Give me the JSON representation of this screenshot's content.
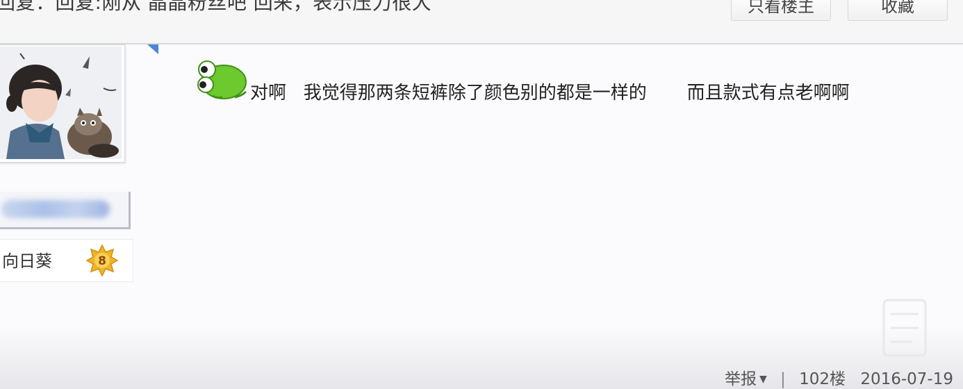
{
  "header": {
    "title": "回复：回复:刚从 晶晶粉丝吧 回来，表示压力很大",
    "only_op_label": "只看楼主",
    "favorite_label": "收藏"
  },
  "user": {
    "level_name": "向日葵",
    "level_number": "8"
  },
  "post": {
    "text": "对啊   我觉得那两条短裤除了颜色别的都是一样的       而且款式有点老啊啊"
  },
  "footer": {
    "report_label": "举报",
    "floor": "102楼",
    "date": "2016-07-19"
  },
  "colors": {
    "accent_blue": "#4a86d6",
    "badge_gold": "#f0b429",
    "emoticon_green": "#6cc92e"
  },
  "icons": [
    "dropdown-arrow-icon",
    "level-badge-icon",
    "frog-emoticon-icon"
  ]
}
